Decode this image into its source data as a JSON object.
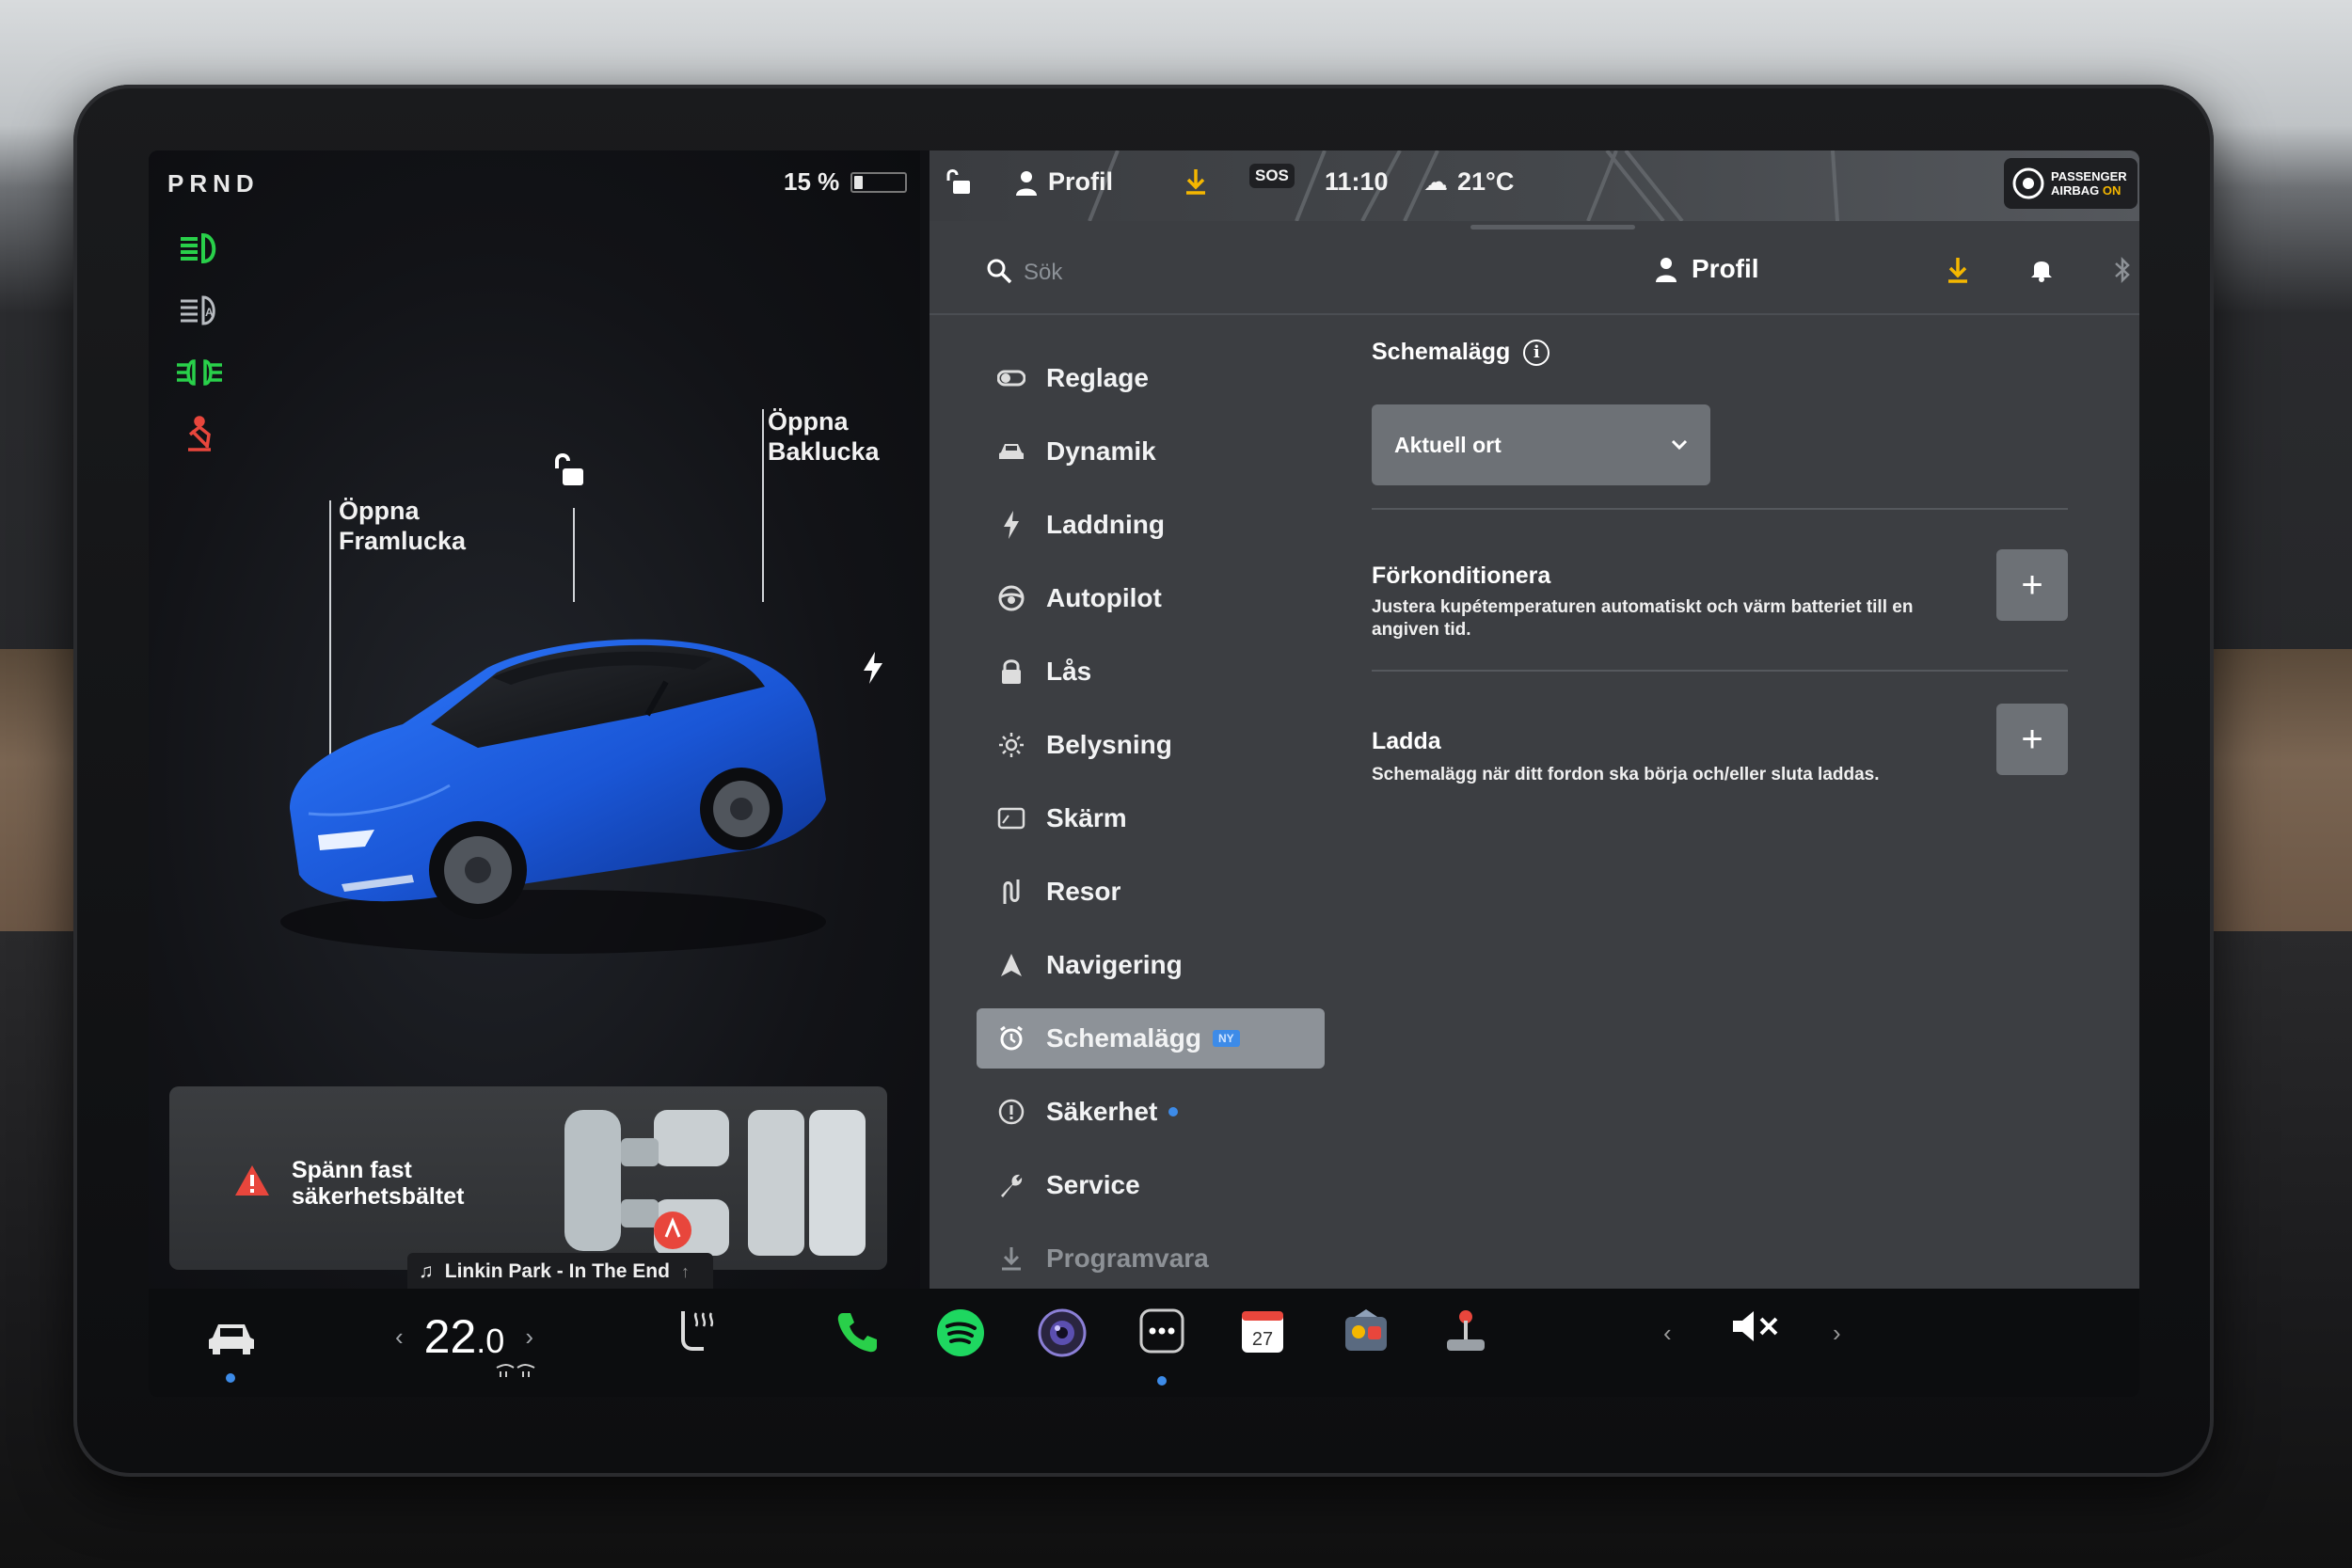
{
  "vehicle": {
    "gear": "PRND",
    "battery_percent": "15 %",
    "battery_level": 0.15,
    "labels": {
      "frunk_line1": "Öppna",
      "frunk_line2": "Framlucka",
      "trunk_line1": "Öppna",
      "trunk_line2": "Baklucka"
    },
    "body_color": "#1f5fd8"
  },
  "warning": {
    "line1": "Spänn fast",
    "line2": "säkerhetsbältet"
  },
  "media": {
    "track": "Linkin Park - In The End"
  },
  "status_bar": {
    "profile": "Profil",
    "sos": "SOS",
    "time": "11:10",
    "temperature": "21°C",
    "airbag_line1": "PASSENGER",
    "airbag_line2_a": "AIRBAG",
    "airbag_line2_b": "ON"
  },
  "search": {
    "placeholder": "Sök",
    "profile_label": "Profil"
  },
  "menu": {
    "items": [
      {
        "label": "Reglage",
        "icon": "toggle-icon"
      },
      {
        "label": "Dynamik",
        "icon": "car-icon"
      },
      {
        "label": "Laddning",
        "icon": "bolt-icon"
      },
      {
        "label": "Autopilot",
        "icon": "steering-wheel-icon"
      },
      {
        "label": "Lås",
        "icon": "lock-icon"
      },
      {
        "label": "Belysning",
        "icon": "sun-icon"
      },
      {
        "label": "Skärm",
        "icon": "display-icon"
      },
      {
        "label": "Resor",
        "icon": "trips-icon"
      },
      {
        "label": "Navigering",
        "icon": "navigation-icon"
      },
      {
        "label": "Schemalägg",
        "icon": "alarm-clock-icon",
        "badge": "NY",
        "active": true
      },
      {
        "label": "Säkerhet",
        "icon": "info-circle-icon",
        "dot": true
      },
      {
        "label": "Service",
        "icon": "wrench-icon"
      },
      {
        "label": "Programvara",
        "icon": "download-icon"
      }
    ]
  },
  "schedule": {
    "title": "Schemalägg",
    "location_select": "Aktuell ort",
    "precondition_title": "Förkonditionera",
    "precondition_desc": "Justera kupétemperaturen automatiskt och värm batteriet till en angiven tid.",
    "charge_title": "Ladda",
    "charge_desc": "Schemalägg när ditt fordon ska börja och/eller sluta laddas.",
    "add_symbol": "+"
  },
  "dock": {
    "temp_whole": "22",
    "temp_decimal": ".0",
    "calendar_day": "27"
  },
  "colors": {
    "accent_blue": "#3d8be8",
    "indicator_green": "#29d04a",
    "alert_red": "#e8463c",
    "download_yellow": "#f5b700"
  }
}
